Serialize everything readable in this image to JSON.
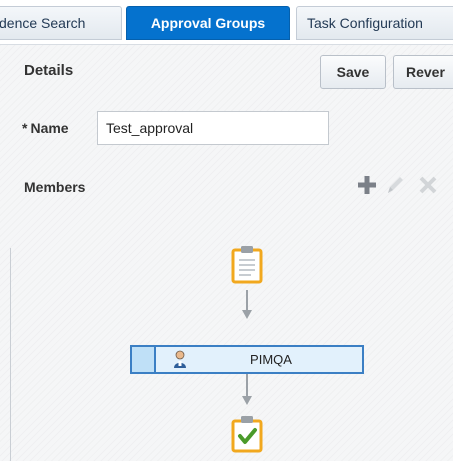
{
  "tabs": [
    {
      "label": "dence Search"
    },
    {
      "label": "Approval Groups",
      "active": true
    },
    {
      "label": "Task Configuration"
    }
  ],
  "details": {
    "title": "Details",
    "save_label": "Save",
    "revert_label": "Rever"
  },
  "name_field": {
    "required_marker": "*",
    "label": "Name",
    "value": "Test_approval"
  },
  "members": {
    "title": "Members",
    "toolbar_icons": [
      "add-icon",
      "edit-icon",
      "delete-icon"
    ],
    "items": [
      {
        "name": "PIMQA",
        "icon": "user-icon",
        "selected": true
      }
    ]
  },
  "colors": {
    "active_tab": "#0572ce",
    "selection_border": "#3b7fc4",
    "selection_fill": "#e2f1fc",
    "clipboard_orange": "#f1a81e",
    "approved_green": "#4a9a2a"
  }
}
